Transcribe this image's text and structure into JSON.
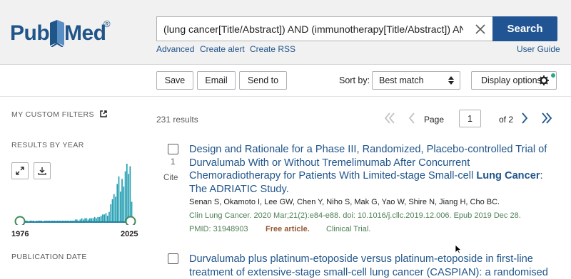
{
  "header": {
    "logo_text_left": "Pub",
    "logo_text_right": "Med",
    "logo_reg": "®",
    "search_query": "(lung cancer[Title/Abstract]) AND (immunotherapy[Title/Abstract]) AND (ra",
    "search_button": "Search",
    "links": {
      "advanced": "Advanced",
      "create_alert": "Create alert",
      "create_rss": "Create RSS",
      "user_guide": "User Guide"
    }
  },
  "toolbar": {
    "save": "Save",
    "email": "Email",
    "send_to": "Send to",
    "sort_label": "Sort by:",
    "sort_value": "Best match",
    "display_options": "Display options"
  },
  "sidebar": {
    "custom_filters": "MY CUSTOM FILTERS",
    "results_by_year": "RESULTS BY YEAR",
    "year_start": "1976",
    "year_end": "2025",
    "publication_date": "PUBLICATION DATE",
    "histogram": [
      1,
      1,
      0,
      1,
      1,
      0,
      1,
      1,
      1,
      0,
      1,
      1,
      1,
      1,
      0,
      1,
      1,
      1,
      1,
      1,
      1,
      1,
      1,
      1,
      1,
      1,
      1,
      1,
      1,
      1,
      1,
      1,
      1,
      1,
      2,
      2,
      1,
      2,
      3,
      2,
      3,
      3,
      2,
      3,
      3,
      3,
      4,
      3,
      4,
      4,
      5,
      6,
      6,
      7,
      5,
      8,
      14,
      18,
      22,
      20,
      30,
      36,
      24,
      34,
      28,
      40,
      46,
      38,
      44,
      16
    ]
  },
  "results": {
    "count": "231 results",
    "page_label": "Page",
    "page_value": "1",
    "page_of": "of 2",
    "items": [
      {
        "number": "1",
        "cite": "Cite",
        "title_lines": [
          [
            "Design and Rationale for a Phase III, Randomized, Placebo-controlled Trial of",
            ""
          ],
          [
            "Durvalumab With or Without Tremelimumab After Concurrent",
            ""
          ],
          [
            "Chemoradiotherapy for Patients With Limited-stage Small-cell ",
            "Lung Cancer",
            ":"
          ],
          [
            "The ADRIATIC Study.",
            ""
          ]
        ],
        "authors": "Senan S, Okamoto I, Lee GW, Chen Y, Niho S, Mak G, Yao W, Shire N, Jiang H, Cho BC.",
        "journal": "Clin Lung Cancer. 2020 Mar;21(2):e84-e88. doi: 10.1016/j.cllc.2019.12.006. Epub 2019 Dec 28.",
        "pmid": "PMID: 31948903",
        "free": "Free article.",
        "type": "Clinical Trial."
      },
      {
        "title_lines": [
          [
            "Durvalumab plus platinum-etoposide versus platinum-etoposide in first-line",
            ""
          ],
          [
            "treatment of extensive-stage small-cell lung cancer (CASPIAN): a randomised",
            ""
          ]
        ]
      }
    ]
  }
}
